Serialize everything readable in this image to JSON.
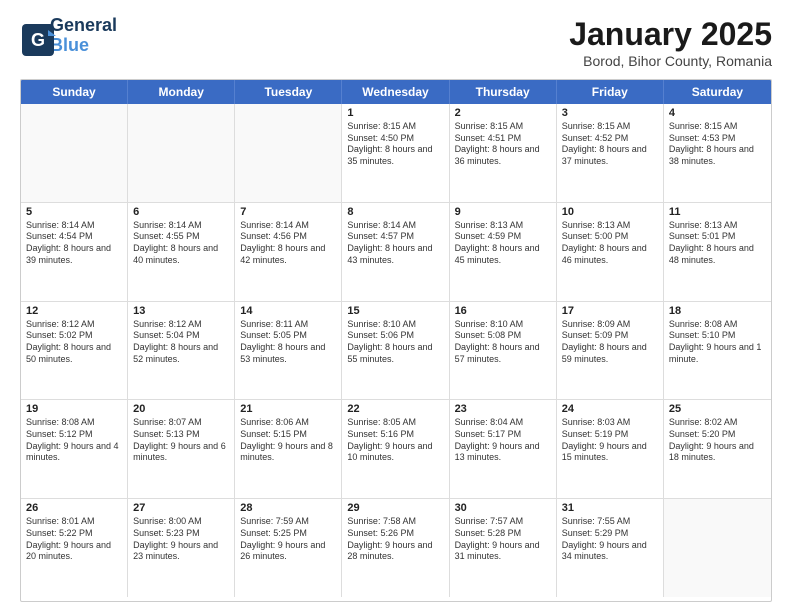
{
  "header": {
    "logo": {
      "line1": "General",
      "line2": "Blue"
    },
    "title": "January 2025",
    "subtitle": "Borod, Bihor County, Romania"
  },
  "calendar": {
    "days_of_week": [
      "Sunday",
      "Monday",
      "Tuesday",
      "Wednesday",
      "Thursday",
      "Friday",
      "Saturday"
    ],
    "weeks": [
      [
        {
          "day": "",
          "empty": true
        },
        {
          "day": "",
          "empty": true
        },
        {
          "day": "",
          "empty": true
        },
        {
          "day": "1",
          "sunrise": "8:15 AM",
          "sunset": "4:50 PM",
          "daylight": "8 hours and 35 minutes."
        },
        {
          "day": "2",
          "sunrise": "8:15 AM",
          "sunset": "4:51 PM",
          "daylight": "8 hours and 36 minutes."
        },
        {
          "day": "3",
          "sunrise": "8:15 AM",
          "sunset": "4:52 PM",
          "daylight": "8 hours and 37 minutes."
        },
        {
          "day": "4",
          "sunrise": "8:15 AM",
          "sunset": "4:53 PM",
          "daylight": "8 hours and 38 minutes."
        }
      ],
      [
        {
          "day": "5",
          "sunrise": "8:14 AM",
          "sunset": "4:54 PM",
          "daylight": "8 hours and 39 minutes."
        },
        {
          "day": "6",
          "sunrise": "8:14 AM",
          "sunset": "4:55 PM",
          "daylight": "8 hours and 40 minutes."
        },
        {
          "day": "7",
          "sunrise": "8:14 AM",
          "sunset": "4:56 PM",
          "daylight": "8 hours and 42 minutes."
        },
        {
          "day": "8",
          "sunrise": "8:14 AM",
          "sunset": "4:57 PM",
          "daylight": "8 hours and 43 minutes."
        },
        {
          "day": "9",
          "sunrise": "8:13 AM",
          "sunset": "4:59 PM",
          "daylight": "8 hours and 45 minutes."
        },
        {
          "day": "10",
          "sunrise": "8:13 AM",
          "sunset": "5:00 PM",
          "daylight": "8 hours and 46 minutes."
        },
        {
          "day": "11",
          "sunrise": "8:13 AM",
          "sunset": "5:01 PM",
          "daylight": "8 hours and 48 minutes."
        }
      ],
      [
        {
          "day": "12",
          "sunrise": "8:12 AM",
          "sunset": "5:02 PM",
          "daylight": "8 hours and 50 minutes."
        },
        {
          "day": "13",
          "sunrise": "8:12 AM",
          "sunset": "5:04 PM",
          "daylight": "8 hours and 52 minutes."
        },
        {
          "day": "14",
          "sunrise": "8:11 AM",
          "sunset": "5:05 PM",
          "daylight": "8 hours and 53 minutes."
        },
        {
          "day": "15",
          "sunrise": "8:10 AM",
          "sunset": "5:06 PM",
          "daylight": "8 hours and 55 minutes."
        },
        {
          "day": "16",
          "sunrise": "8:10 AM",
          "sunset": "5:08 PM",
          "daylight": "8 hours and 57 minutes."
        },
        {
          "day": "17",
          "sunrise": "8:09 AM",
          "sunset": "5:09 PM",
          "daylight": "8 hours and 59 minutes."
        },
        {
          "day": "18",
          "sunrise": "8:08 AM",
          "sunset": "5:10 PM",
          "daylight": "9 hours and 1 minute."
        }
      ],
      [
        {
          "day": "19",
          "sunrise": "8:08 AM",
          "sunset": "5:12 PM",
          "daylight": "9 hours and 4 minutes."
        },
        {
          "day": "20",
          "sunrise": "8:07 AM",
          "sunset": "5:13 PM",
          "daylight": "9 hours and 6 minutes."
        },
        {
          "day": "21",
          "sunrise": "8:06 AM",
          "sunset": "5:15 PM",
          "daylight": "9 hours and 8 minutes."
        },
        {
          "day": "22",
          "sunrise": "8:05 AM",
          "sunset": "5:16 PM",
          "daylight": "9 hours and 10 minutes."
        },
        {
          "day": "23",
          "sunrise": "8:04 AM",
          "sunset": "5:17 PM",
          "daylight": "9 hours and 13 minutes."
        },
        {
          "day": "24",
          "sunrise": "8:03 AM",
          "sunset": "5:19 PM",
          "daylight": "9 hours and 15 minutes."
        },
        {
          "day": "25",
          "sunrise": "8:02 AM",
          "sunset": "5:20 PM",
          "daylight": "9 hours and 18 minutes."
        }
      ],
      [
        {
          "day": "26",
          "sunrise": "8:01 AM",
          "sunset": "5:22 PM",
          "daylight": "9 hours and 20 minutes."
        },
        {
          "day": "27",
          "sunrise": "8:00 AM",
          "sunset": "5:23 PM",
          "daylight": "9 hours and 23 minutes."
        },
        {
          "day": "28",
          "sunrise": "7:59 AM",
          "sunset": "5:25 PM",
          "daylight": "9 hours and 26 minutes."
        },
        {
          "day": "29",
          "sunrise": "7:58 AM",
          "sunset": "5:26 PM",
          "daylight": "9 hours and 28 minutes."
        },
        {
          "day": "30",
          "sunrise": "7:57 AM",
          "sunset": "5:28 PM",
          "daylight": "9 hours and 31 minutes."
        },
        {
          "day": "31",
          "sunrise": "7:55 AM",
          "sunset": "5:29 PM",
          "daylight": "9 hours and 34 minutes."
        },
        {
          "day": "",
          "empty": true
        }
      ]
    ]
  }
}
